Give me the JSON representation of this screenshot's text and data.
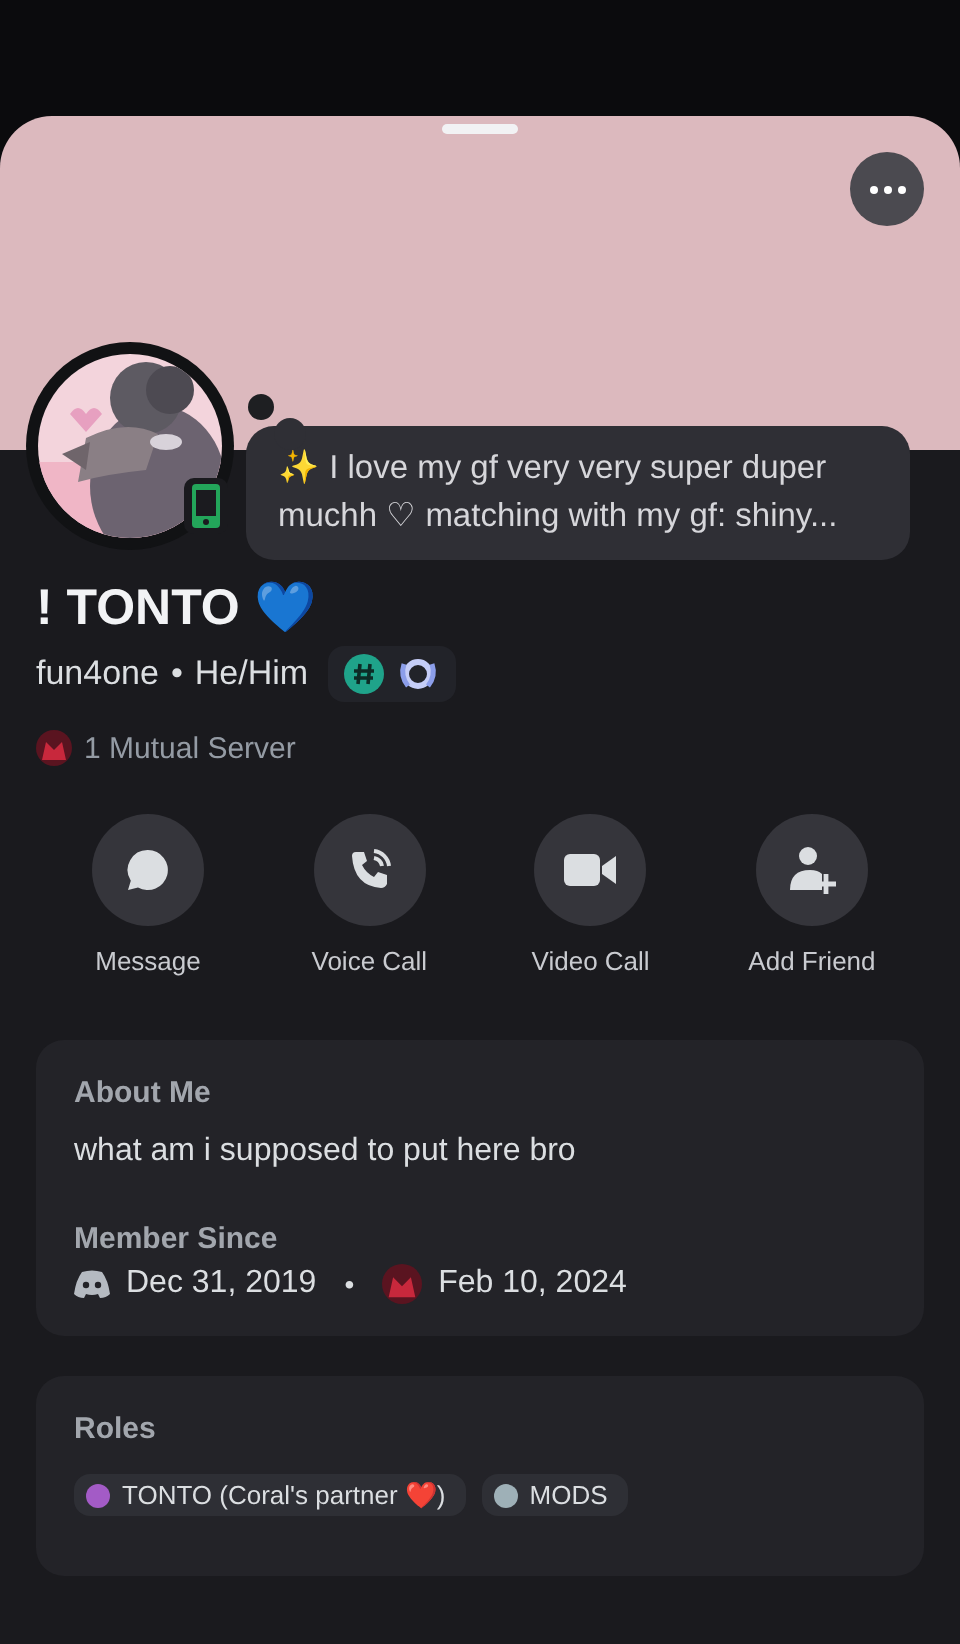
{
  "profile": {
    "online_on_mobile": true,
    "custom_status": "✨ I love my gf very very super duper muchh ♡ matching with my gf: shiny...",
    "display_name": "! TONTO 💙",
    "username": "fun4one",
    "separator": "•",
    "pronouns": "He/Him",
    "mutual_servers": "1 Mutual Server"
  },
  "actions": [
    {
      "label": "Message",
      "kind": "message"
    },
    {
      "label": "Voice Call",
      "kind": "voice"
    },
    {
      "label": "Video Call",
      "kind": "video"
    },
    {
      "label": "Add Friend",
      "kind": "add-friend"
    }
  ],
  "about": {
    "heading": "About Me",
    "text": "what am i supposed to put here bro"
  },
  "member_since": {
    "heading": "Member Since",
    "discord_date": "Dec 31, 2019",
    "separator": "•",
    "server_date": "Feb 10, 2024"
  },
  "roles": {
    "heading": "Roles",
    "items": [
      {
        "name": "TONTO (Coral's partner ❤️)",
        "color": "#a35bc6"
      },
      {
        "name": "MODS",
        "color": "#9eb0b7"
      }
    ]
  }
}
